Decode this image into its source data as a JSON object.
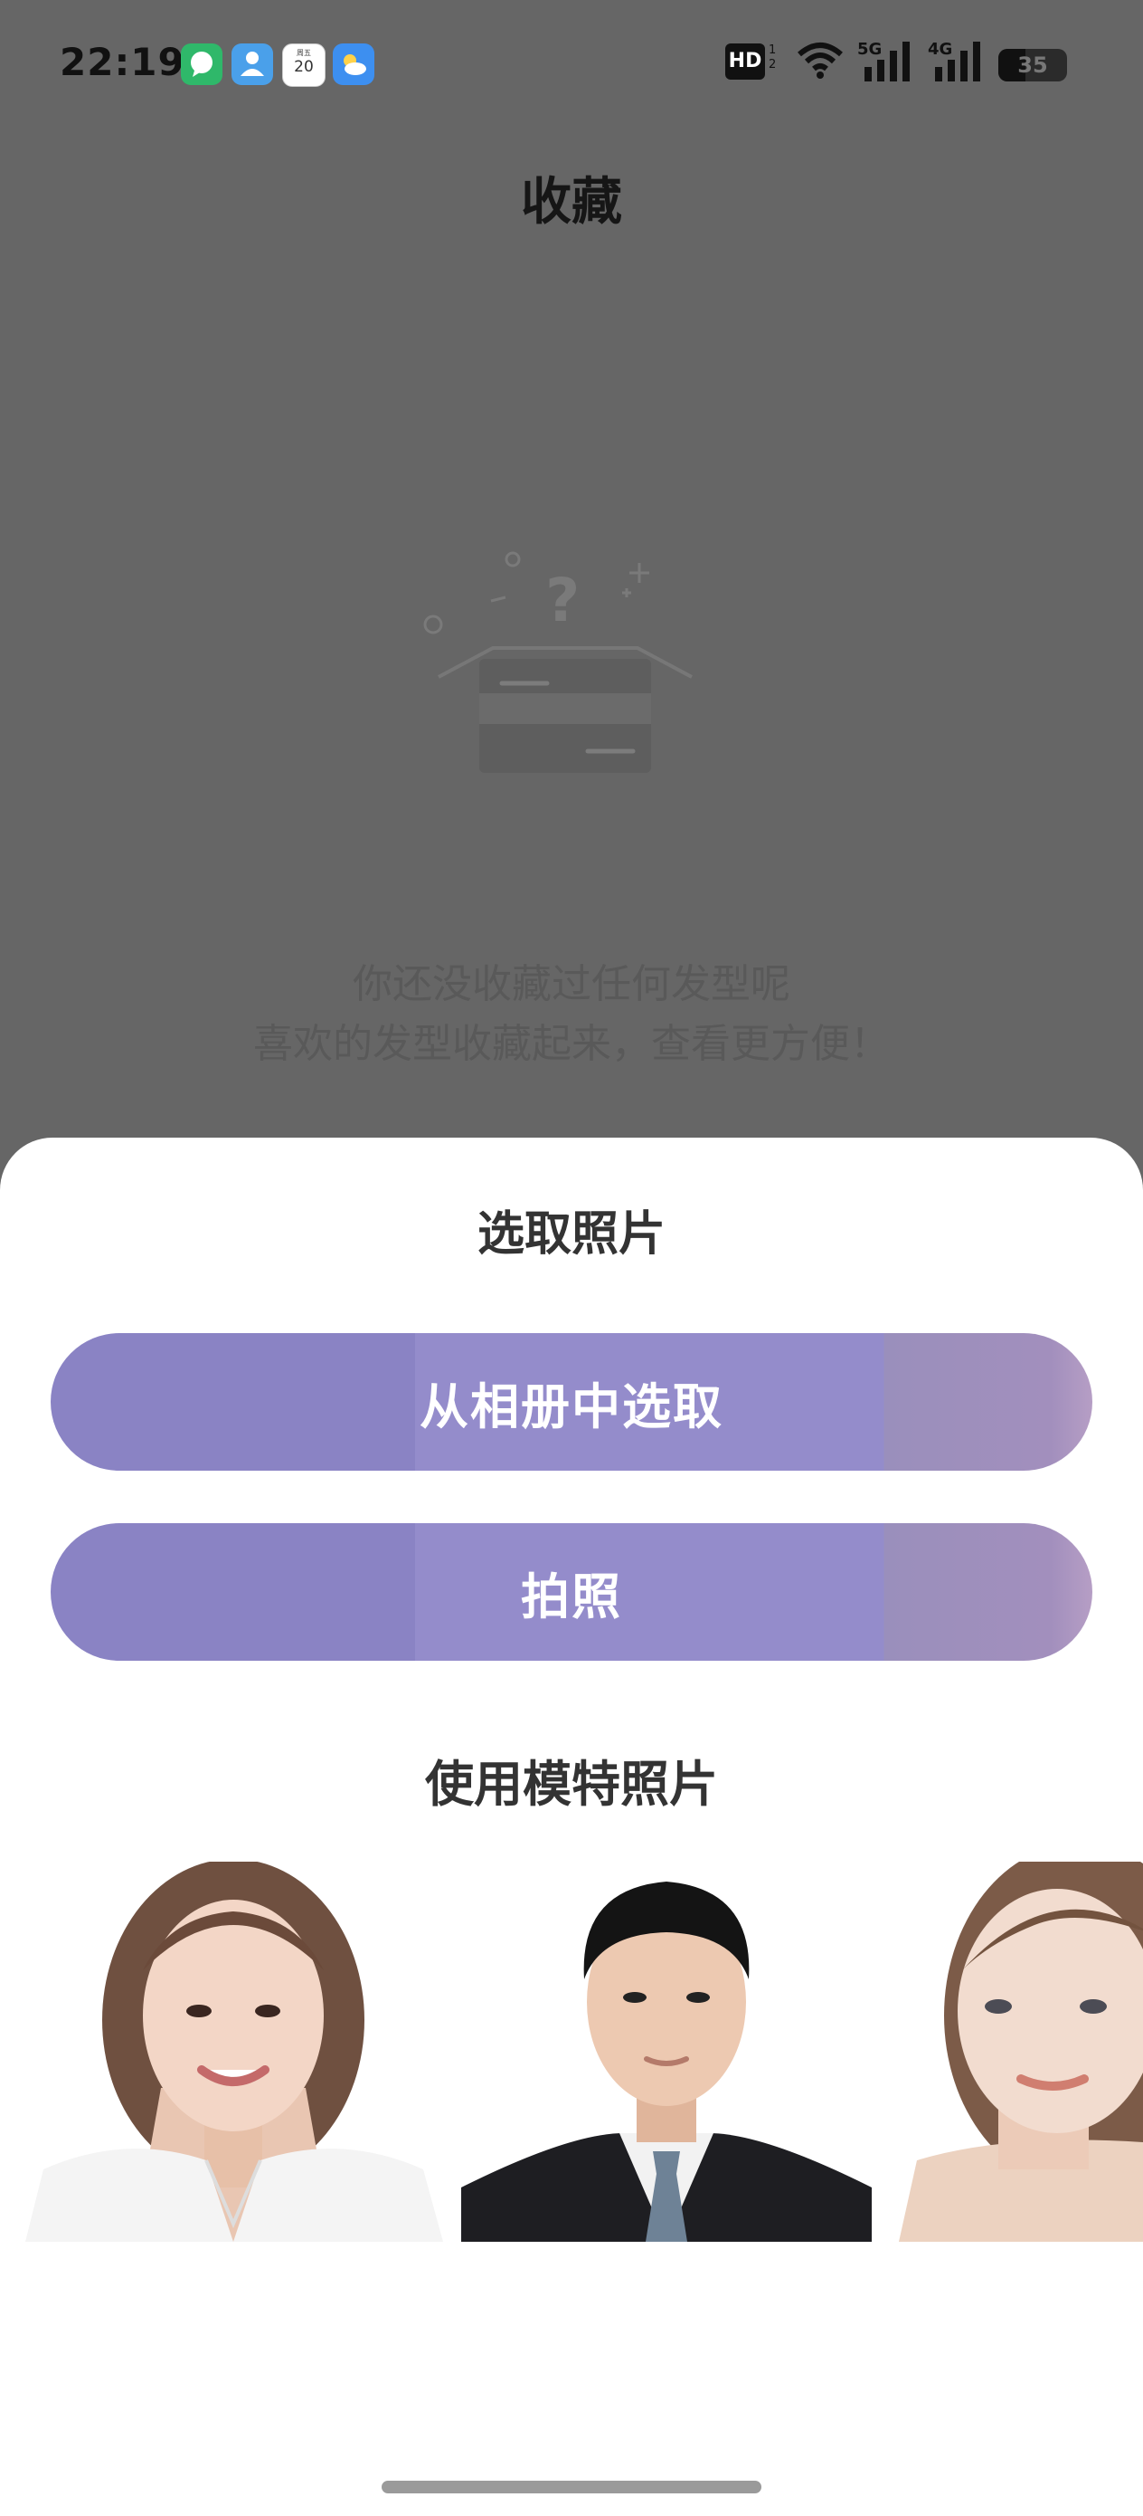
{
  "status_bar": {
    "time": "22:19",
    "calendar_month": "周五",
    "calendar_day": "20",
    "hd_label": "HD",
    "sim1_network": "5G",
    "sim2_network": "4G",
    "battery": "35",
    "icons": [
      "chat-app-icon",
      "person-app-icon",
      "calendar-app-icon",
      "weather-app-icon",
      "hd-icon",
      "wifi-icon",
      "signal-5g-icon",
      "signal-4g-icon",
      "battery-icon"
    ]
  },
  "page": {
    "title": "收藏",
    "empty_line1": "你还没收藏过任何发型呢",
    "empty_line2": "喜欢的发型收藏起来，查看更方便！"
  },
  "sheet": {
    "title": "选取照片",
    "album_button": "从相册中选取",
    "camera_button": "拍照",
    "models_title": "使用模特照片",
    "models": [
      "female-model-1",
      "male-model",
      "female-model-2"
    ]
  },
  "colors": {
    "overlay": "#666666",
    "button": "#8a83c4",
    "sheet": "#ffffff"
  }
}
